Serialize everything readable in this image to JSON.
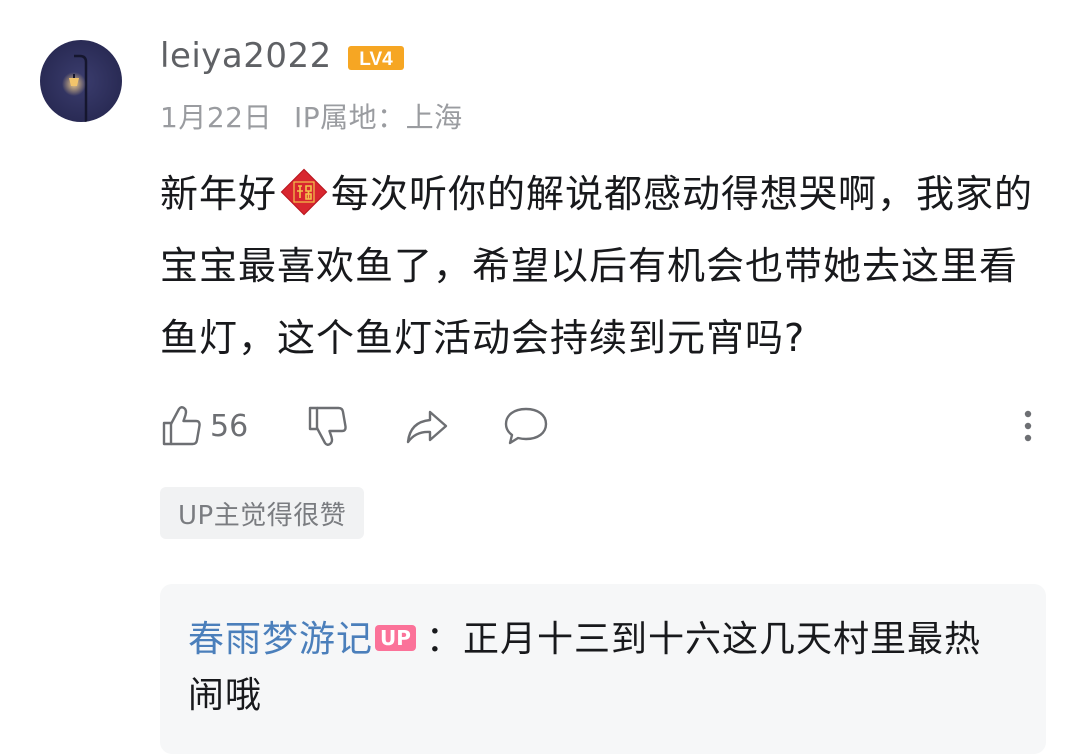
{
  "comment": {
    "avatar_icon": "streetlamp-night-icon",
    "username": "leiya2022",
    "level_badge": "LV4",
    "level_color": "#f6a623",
    "date": "1月22日",
    "ip_location": "IP属地：上海",
    "content_before_emoji": "新年好",
    "emoji_icon": "fu-blessing-icon",
    "content_after_emoji": "每次听你的解说都感动得想哭啊，我家的宝宝最喜欢鱼了，希望以后有机会也带她去这里看鱼灯，这个鱼灯活动会持续到元宵吗?",
    "actions": {
      "like_icon": "thumbs-up-icon",
      "like_count": "56",
      "dislike_icon": "thumbs-down-icon",
      "share_icon": "share-arrow-icon",
      "reply_icon": "speech-bubble-icon",
      "more_icon": "more-vertical-icon"
    },
    "up_liked_tag": "UP主觉得很赞"
  },
  "reply": {
    "author": "春雨梦游记",
    "author_badge": "UP",
    "author_color": "#4b7fbb",
    "badge_color": "#fb7299",
    "separator": "：",
    "text": "正月十三到十六这几天村里最热闹哦"
  }
}
